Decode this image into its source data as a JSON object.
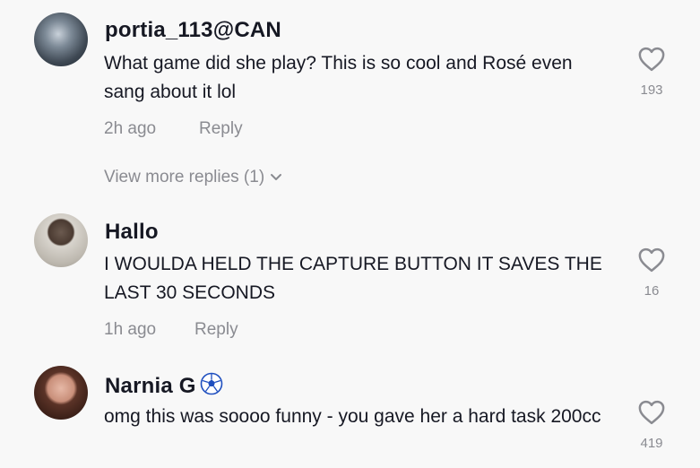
{
  "comments": [
    {
      "username": "portia_113@CAN",
      "text": "What game did she play? This is so cool and Rosé even sang about it lol",
      "time": "2h ago",
      "reply_label": "Reply",
      "likes": "193",
      "view_more": "View more replies (1)"
    },
    {
      "username": "Hallo",
      "text": "I WOULDA HELD THE CAPTURE BUTTON IT SAVES THE LAST 30 SECONDS",
      "time": "1h ago",
      "reply_label": "Reply",
      "likes": "16"
    },
    {
      "username": "Narnia G",
      "text": "omg this was soooo funny - you gave her a hard task 200cc",
      "likes": "419",
      "badge_icon": "soccer-ball-icon"
    }
  ],
  "colors": {
    "background": "#f8f8f8",
    "primary_text": "#161823",
    "secondary_text": "#8a8b91"
  }
}
